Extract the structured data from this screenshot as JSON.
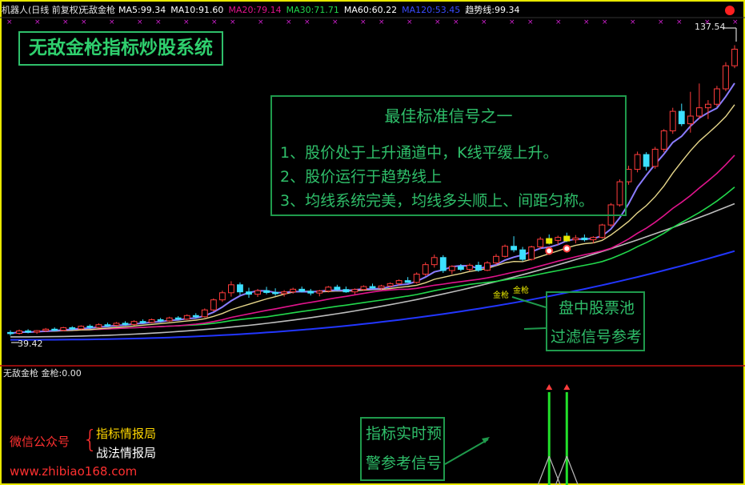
{
  "header": {
    "title": "机器人(日线 前复权)",
    "indicator_name": "无敌金枪",
    "ma": [
      {
        "label": "MA5:",
        "value": "99.34",
        "color": "#ffffff"
      },
      {
        "label": "MA10:",
        "value": "91.60",
        "color": "#ffffff"
      },
      {
        "label": "MA20:",
        "value": "79.14",
        "color": "#e0148c"
      },
      {
        "label": "MA30:",
        "value": "71.71",
        "color": "#22d84c"
      },
      {
        "label": "MA60:",
        "value": "60.22",
        "color": "#ffffff"
      },
      {
        "label": "MA120:",
        "value": "53.45",
        "color": "#3a4cff"
      },
      {
        "label": "趋势线:",
        "value": "99.34",
        "color": "#ffffff"
      }
    ]
  },
  "banner": {
    "text": "无敌金枪指标炒股系统"
  },
  "signal_box": {
    "title": "最佳标准信号之一",
    "lines": [
      "1、股价处于上升通道中，K线平缓上升。",
      "2、股价运行于趋势线上",
      "3、均线系统完美，均线多头顺上、间距匀称。"
    ]
  },
  "pool_box": {
    "line1": "盘中股票池",
    "line2": "过滤信号参考"
  },
  "alert_box": {
    "line1": "指标实时预",
    "line2": "警参考信号"
  },
  "signal_labels": [
    "金枪",
    "金枪"
  ],
  "lower_panel": {
    "name": "无敌金枪",
    "field": "金枪:",
    "value": "0.00"
  },
  "watermark": {
    "wechat_label": "微信公众号",
    "accounts": [
      "指标情报局",
      "战法情报局"
    ],
    "site": "www.zhibiao168.com"
  },
  "chart_data": {
    "type": "candlestick",
    "price_high_label": "137.54",
    "price_low_label": "39.42",
    "ylim": [
      36,
      142
    ],
    "colors": {
      "up": "#ff3c3c",
      "down": "#3ce0ff",
      "accent": "#e8e800",
      "signal": "#22e02a"
    },
    "ohlc": [
      [
        40.5,
        41.2,
        39.42,
        40.2
      ],
      [
        40.2,
        41.5,
        39.8,
        41.0
      ],
      [
        41.0,
        41.6,
        40.2,
        40.6
      ],
      [
        40.6,
        41.3,
        40.0,
        41.1
      ],
      [
        41.1,
        42.0,
        40.6,
        41.6
      ],
      [
        41.6,
        42.2,
        40.9,
        41.2
      ],
      [
        41.2,
        42.4,
        40.9,
        42.1
      ],
      [
        42.1,
        42.6,
        41.3,
        41.7
      ],
      [
        41.7,
        42.9,
        41.4,
        42.6
      ],
      [
        42.6,
        43.2,
        41.8,
        42.2
      ],
      [
        42.2,
        43.6,
        41.9,
        43.1
      ],
      [
        43.1,
        43.8,
        42.4,
        42.9
      ],
      [
        42.9,
        44.0,
        42.5,
        43.6
      ],
      [
        43.6,
        44.3,
        42.8,
        43.2
      ],
      [
        43.2,
        44.6,
        42.9,
        44.2
      ],
      [
        44.2,
        44.9,
        43.5,
        43.9
      ],
      [
        43.9,
        45.2,
        43.6,
        44.8
      ],
      [
        44.8,
        45.4,
        44.0,
        44.4
      ],
      [
        44.4,
        45.8,
        44.1,
        45.4
      ],
      [
        45.4,
        46.0,
        44.6,
        45.0
      ],
      [
        45.0,
        46.6,
        44.7,
        46.2
      ],
      [
        46.2,
        47.0,
        45.3,
        45.8
      ],
      [
        45.8,
        48.6,
        45.5,
        48.1
      ],
      [
        48.1,
        52.0,
        47.6,
        51.5
      ],
      [
        51.5,
        54.6,
        50.8,
        53.9
      ],
      [
        53.9,
        57.8,
        52.6,
        56.6
      ],
      [
        56.6,
        57.4,
        53.2,
        54.2
      ],
      [
        54.2,
        55.6,
        52.2,
        53.4
      ],
      [
        53.4,
        55.2,
        52.5,
        54.6
      ],
      [
        54.6,
        55.9,
        53.4,
        54.0
      ],
      [
        54.0,
        55.4,
        52.9,
        53.6
      ],
      [
        53.6,
        54.8,
        52.6,
        54.2
      ],
      [
        54.2,
        55.6,
        53.6,
        55.1
      ],
      [
        55.1,
        56.0,
        54.0,
        54.4
      ],
      [
        54.4,
        55.2,
        53.0,
        53.8
      ],
      [
        53.8,
        54.9,
        52.7,
        54.5
      ],
      [
        54.5,
        56.2,
        54.0,
        55.8
      ],
      [
        55.8,
        56.6,
        54.6,
        55.0
      ],
      [
        55.0,
        56.0,
        53.9,
        54.2
      ],
      [
        54.2,
        55.4,
        53.4,
        55.0
      ],
      [
        55.0,
        56.4,
        54.5,
        56.0
      ],
      [
        56.0,
        57.0,
        55.2,
        55.5
      ],
      [
        55.5,
        56.6,
        54.9,
        56.2
      ],
      [
        56.2,
        57.4,
        55.6,
        57.0
      ],
      [
        57.0,
        58.4,
        56.4,
        58.0
      ],
      [
        58.0,
        59.2,
        57.2,
        57.4
      ],
      [
        57.4,
        60.8,
        57.0,
        60.2
      ],
      [
        60.2,
        64.2,
        59.6,
        63.4
      ],
      [
        63.4,
        66.8,
        62.4,
        65.8
      ],
      [
        65.8,
        66.6,
        60.6,
        61.4
      ],
      [
        61.4,
        63.2,
        60.2,
        62.8
      ],
      [
        62.8,
        63.6,
        61.2,
        61.8
      ],
      [
        61.8,
        63.8,
        61.2,
        63.2
      ],
      [
        63.2,
        64.4,
        61.0,
        61.5
      ],
      [
        61.5,
        64.6,
        61.2,
        64.0
      ],
      [
        64.0,
        67.0,
        63.4,
        66.2
      ],
      [
        66.2,
        70.2,
        65.8,
        69.6
      ],
      [
        69.6,
        73.0,
        67.6,
        68.4
      ],
      [
        68.4,
        69.4,
        64.6,
        65.2
      ],
      [
        65.2,
        69.8,
        64.8,
        69.4
      ],
      [
        69.4,
        72.8,
        68.6,
        72.0
      ],
      [
        72.0,
        73.6,
        70.2,
        71.6
      ],
      [
        71.6,
        73.2,
        70.0,
        72.6
      ],
      [
        72.6,
        74.2,
        71.0,
        71.8
      ],
      [
        71.8,
        73.4,
        70.6,
        72.4
      ],
      [
        72.4,
        73.6,
        71.2,
        71.8
      ],
      [
        71.8,
        73.0,
        70.6,
        72.6
      ],
      [
        72.6,
        77.2,
        72.2,
        76.8
      ],
      [
        76.8,
        84.2,
        76.2,
        83.6
      ],
      [
        83.6,
        92.2,
        83.0,
        91.4
      ],
      [
        91.4,
        96.8,
        90.4,
        95.6
      ],
      [
        95.6,
        101.6,
        94.6,
        100.6
      ],
      [
        100.6,
        101.4,
        95.2,
        96.6
      ],
      [
        96.6,
        103.2,
        95.8,
        102.4
      ],
      [
        102.4,
        109.2,
        101.4,
        108.6
      ],
      [
        108.6,
        116.4,
        107.6,
        115.2
      ],
      [
        115.2,
        117.8,
        110.2,
        111.0
      ],
      [
        111.0,
        121.8,
        108.0,
        113.6
      ],
      [
        113.6,
        124.6,
        112.6,
        116.4
      ],
      [
        116.4,
        119.0,
        112.6,
        117.6
      ],
      [
        117.6,
        123.8,
        116.8,
        122.8
      ],
      [
        122.8,
        131.8,
        122.0,
        130.6
      ],
      [
        130.6,
        137.54,
        129.8,
        136.2
      ]
    ],
    "signal_bars": [
      61,
      63
    ]
  }
}
